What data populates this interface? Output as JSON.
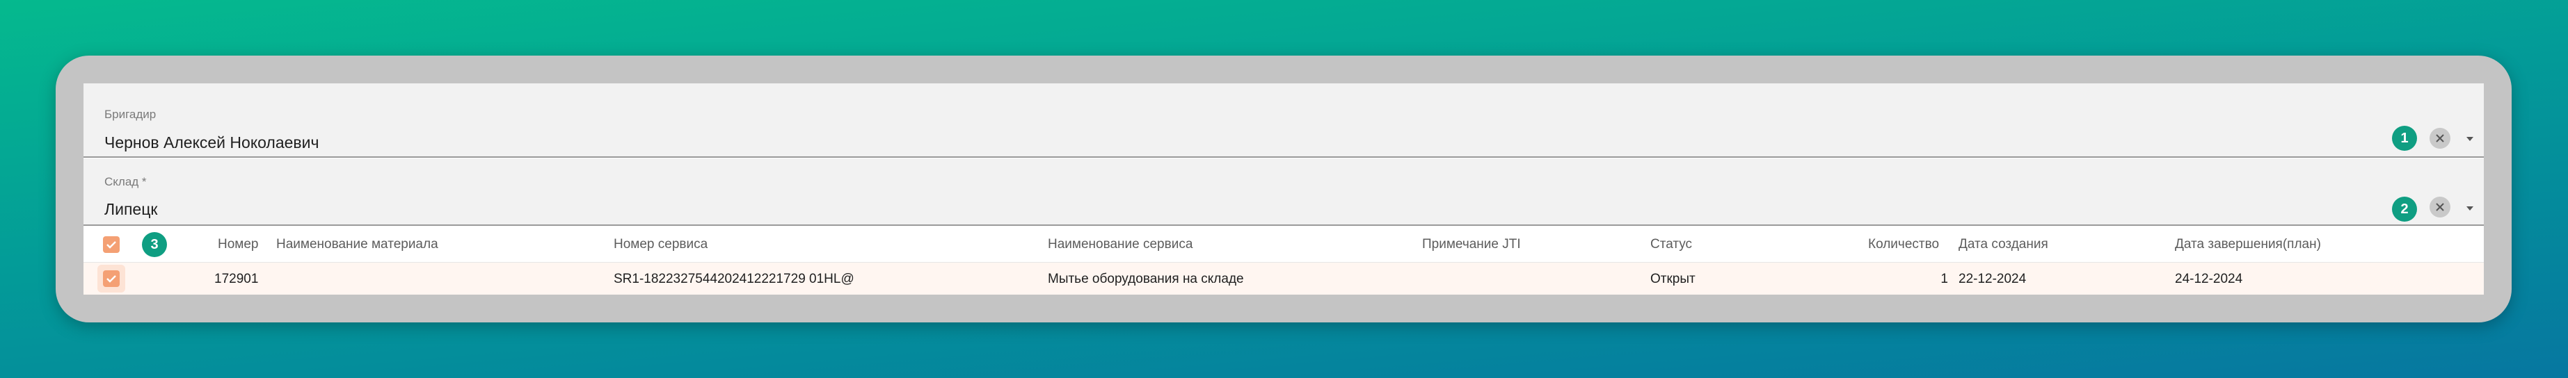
{
  "foreman": {
    "label": "Бригадир",
    "value": "Чернов Алексей Ноколаевич",
    "badge": "1"
  },
  "warehouse": {
    "label": "Склад *",
    "value": "Липецк",
    "badge": "2"
  },
  "table": {
    "select_badge": "3",
    "columns": {
      "number": "Номер",
      "material_name": "Наименование материала",
      "service_number": "Номер сервиса",
      "service_name": "Наименование сервиса",
      "note": "Примечание JTI",
      "status": "Статус",
      "quantity": "Количество",
      "created": "Дата создания",
      "planned_end": "Дата завершения(план)"
    },
    "rows": [
      {
        "number": "172901",
        "material_name": "",
        "service_number": "SR1-1822327544202412221729 01HL@",
        "service_name": "Мытье оборудования на складе",
        "note": "",
        "status": "Открыт",
        "quantity": "1",
        "created": "22-12-2024",
        "planned_end": "24-12-2024"
      }
    ]
  },
  "colors": {
    "accent_badge": "#0f9e82",
    "checkbox": "#f4a074",
    "row_selected": "#fff6f1"
  }
}
